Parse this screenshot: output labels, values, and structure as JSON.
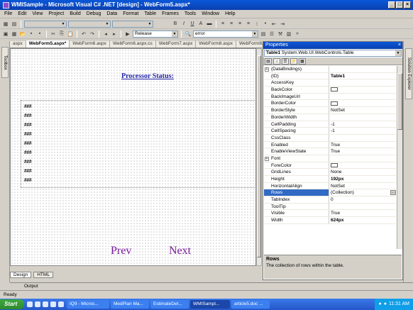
{
  "window": {
    "title": "WMISample - Microsoft Visual C# .NET [design] - WebForm5.aspx*"
  },
  "menu": [
    "File",
    "Edit",
    "View",
    "Project",
    "Build",
    "Debug",
    "Data",
    "Format",
    "Table",
    "Frames",
    "Tools",
    "Window",
    "Help"
  ],
  "toolbar": {
    "config": "Release",
    "find": "error"
  },
  "left_panel": {
    "toolbox_label": "Toolbox"
  },
  "doc_tabs": [
    "aspx",
    "WebForm5.aspx*",
    "WebForm6.aspx",
    "WebForm6.aspx.cs",
    "WebForm7.aspx",
    "WebForm8.aspx",
    "WebForm8.a"
  ],
  "designer": {
    "heading": "Processor Status:",
    "rows": [
      "###",
      "###",
      "###",
      "###",
      "###",
      "###",
      "###",
      "###",
      "###",
      "###"
    ],
    "prev": "Prev",
    "next": "Next"
  },
  "view_tabs": {
    "design": "Design",
    "html": "HTML"
  },
  "output_tab": "Output",
  "status": "Ready",
  "properties": {
    "title": "Properties",
    "object": "Table1",
    "object_type": "System.Web.UI.WebControls.Table",
    "rows": [
      {
        "name": "(DataBindings)",
        "value": ""
      },
      {
        "name": "(ID)",
        "value": "Table1"
      },
      {
        "name": "AccessKey",
        "value": ""
      },
      {
        "name": "BackColor",
        "value": ""
      },
      {
        "name": "BackImageUrl",
        "value": ""
      },
      {
        "name": "BorderColor",
        "value": ""
      },
      {
        "name": "BorderStyle",
        "value": "NotSet"
      },
      {
        "name": "BorderWidth",
        "value": ""
      },
      {
        "name": "CellPadding",
        "value": "-1"
      },
      {
        "name": "CellSpacing",
        "value": "-1"
      },
      {
        "name": "CssClass",
        "value": ""
      },
      {
        "name": "Enabled",
        "value": "True"
      },
      {
        "name": "EnableViewState",
        "value": "True"
      },
      {
        "name": "Font",
        "value": ""
      },
      {
        "name": "ForeColor",
        "value": ""
      },
      {
        "name": "GridLines",
        "value": "None"
      },
      {
        "name": "Height",
        "value": "192px"
      },
      {
        "name": "HorizontalAlign",
        "value": "NotSet"
      },
      {
        "name": "Rows",
        "value": "(Collection)"
      },
      {
        "name": "TabIndex",
        "value": "0"
      },
      {
        "name": "ToolTip",
        "value": ""
      },
      {
        "name": "Visible",
        "value": "True"
      },
      {
        "name": "Width",
        "value": "624px"
      }
    ],
    "desc_title": "Rows",
    "desc_text": "The collection of rows within the table."
  },
  "right_panel": {
    "solution_label": "Solution Explorer"
  },
  "taskbar": {
    "start": "Start",
    "tasks": [
      "IQ9 - Micros...",
      "MedPlan Ma...",
      "EstimateDet...",
      "WMISampl...",
      "article5.doc ..."
    ],
    "clock": "11:31 AM"
  }
}
